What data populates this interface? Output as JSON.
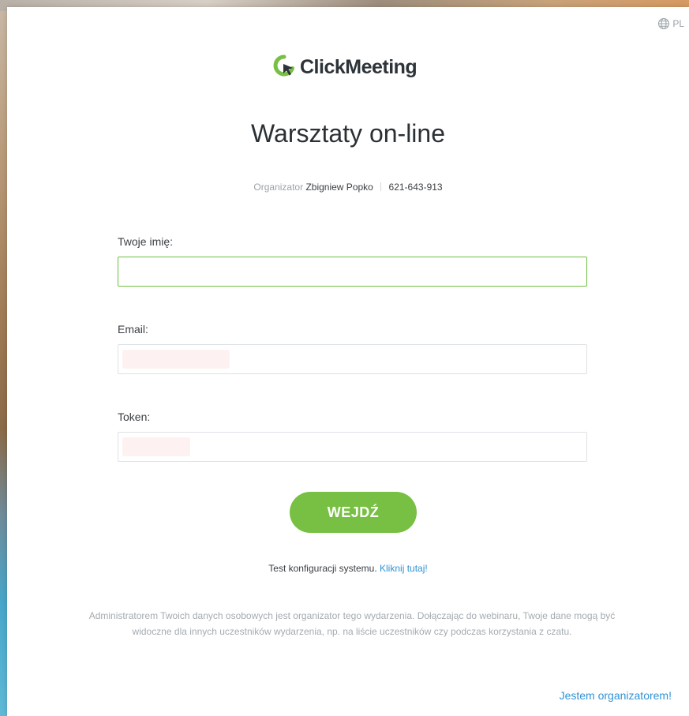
{
  "language": {
    "code": "PL",
    "icon": "globe-icon"
  },
  "brand": {
    "name": "ClickMeeting",
    "accent": "#77c043"
  },
  "event": {
    "title": "Warsztaty on-line",
    "organizer_label": "Organizator",
    "organizer_name": "Zbigniew Popko",
    "event_id": "621-643-913"
  },
  "form": {
    "name_label": "Twoje imię:",
    "name_value": "",
    "email_label": "Email:",
    "email_value": "",
    "token_label": "Token:",
    "token_value": "",
    "submit_label": "WEJDŹ"
  },
  "system_check": {
    "text": "Test konfiguracji systemu.",
    "link": "Kliknij tutaj!"
  },
  "privacy_notice": "Administratorem Twoich danych osobowych jest organizator tego wydarzenia. Dołączając do webinaru, Twoje dane mogą być widoczne dla innych uczestników wydarzenia, np. na liście uczestników czy podczas korzystania z czatu.",
  "organizer_login_link": "Jestem organizatorem!"
}
